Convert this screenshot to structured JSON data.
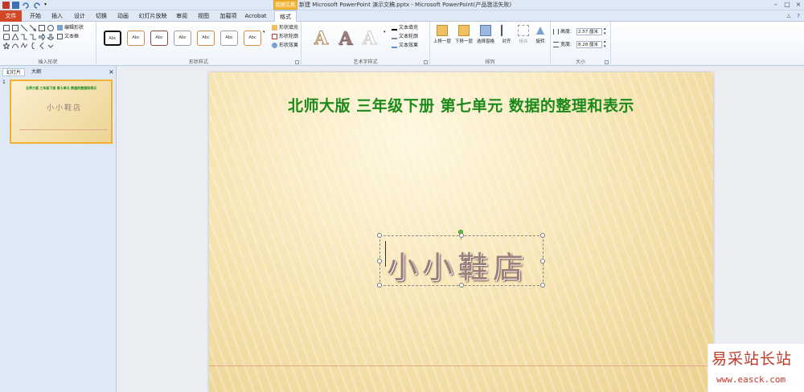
{
  "window": {
    "title": "新建 Microsoft PowerPoint 演示文稿.pptx - Microsoft PowerPoint(产品激活失败)",
    "context_tab": "绘图工具"
  },
  "tabs": [
    {
      "label": "文件"
    },
    {
      "label": "开始"
    },
    {
      "label": "插入"
    },
    {
      "label": "设计"
    },
    {
      "label": "切换"
    },
    {
      "label": "动画"
    },
    {
      "label": "幻灯片放映"
    },
    {
      "label": "审阅"
    },
    {
      "label": "视图"
    },
    {
      "label": "加载项"
    },
    {
      "label": "Acrobat"
    },
    {
      "label": "格式"
    }
  ],
  "ribbon": {
    "insert_shapes": {
      "label": "插入形状",
      "edit_shape": "编辑形状",
      "text_box": "文本框"
    },
    "shape_styles": {
      "label": "形状样式",
      "style_sample": "Abc",
      "fill": "形状填充",
      "outline": "形状轮廓",
      "effects": "形状效果"
    },
    "wordart": {
      "label": "艺术字样式",
      "sample": "A",
      "text_fill": "文本填充",
      "text_outline": "文本轮廓",
      "text_effects": "文本效果"
    },
    "arrange": {
      "label": "排列",
      "bring_forward": "上移一层",
      "send_backward": "下移一层",
      "selection_pane": "选择窗格",
      "align": "对齐",
      "group": "组合",
      "rotate": "旋转"
    },
    "size": {
      "label": "大小",
      "height_label": "高度:",
      "height_value": "2.57 厘米",
      "width_label": "宽度:",
      "width_value": "8.28 厘米"
    }
  },
  "left_pane": {
    "tab_slides": "幻灯片",
    "tab_outline": "大纲",
    "slide_number": "1",
    "thumb_title": "北师大版 三年级下册 第七单元 数据的整理和表示",
    "thumb_text": "小小鞋店"
  },
  "slide": {
    "title": "北师大版  三年级下册  第七单元  数据的整理和表示",
    "textbox_text": "小小鞋店"
  },
  "watermark": {
    "site": "易采站长站",
    "url": "www.easck.com"
  },
  "colors": {
    "title_green": "#1b8a1b",
    "file_tab": "#d24726",
    "context_tab": "#f5b841"
  }
}
